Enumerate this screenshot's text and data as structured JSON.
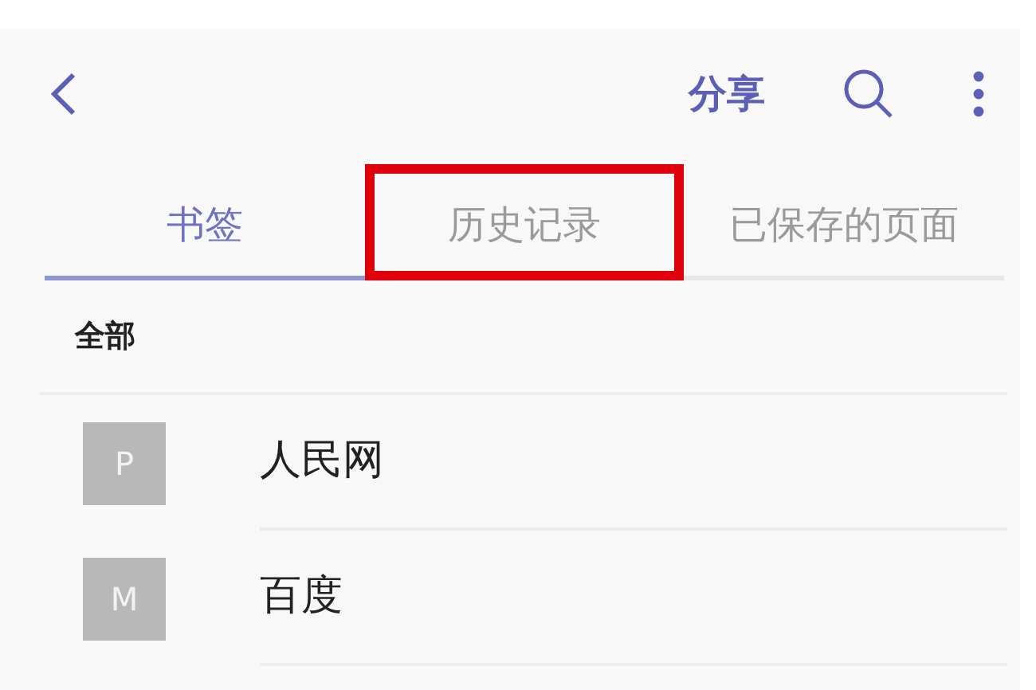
{
  "toolbar": {
    "share": "分享"
  },
  "tabs": [
    {
      "label": "书签",
      "selected": true,
      "highlighted": false
    },
    {
      "label": "历史记录",
      "selected": false,
      "highlighted": true
    },
    {
      "label": "已保存的页面",
      "selected": false,
      "highlighted": false
    }
  ],
  "section": {
    "title": "全部"
  },
  "bookmarks": [
    {
      "letter": "P",
      "title": "人民网"
    },
    {
      "letter": "M",
      "title": "百度"
    }
  ]
}
